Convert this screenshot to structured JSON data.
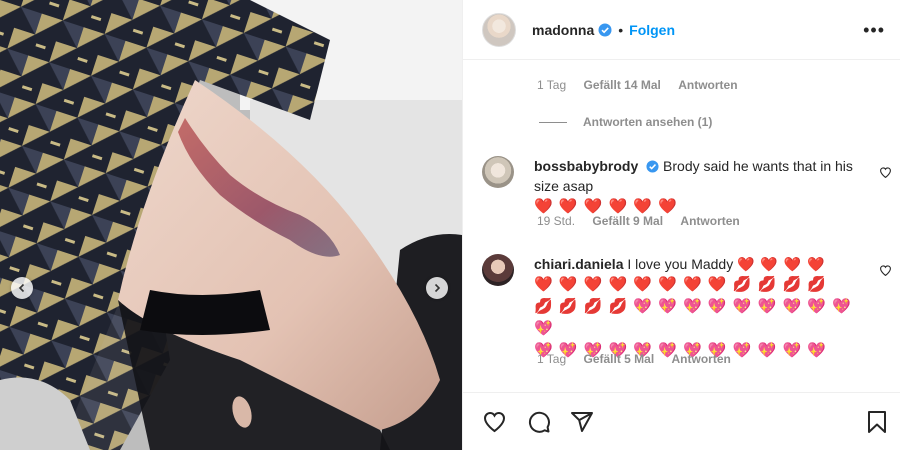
{
  "header": {
    "username": "madonna",
    "separator": "•",
    "follow_label": "Folgen",
    "more_label": "•••"
  },
  "top_reply_meta": {
    "time": "1 Tag",
    "likes": "Gefällt 14 Mal",
    "reply_label": "Antworten"
  },
  "view_replies_label": "Antworten ansehen (1)",
  "comments": [
    {
      "username": "bossbabybrody",
      "verified": true,
      "text": "Brody said he wants that in his size asap",
      "emoji_lines": [
        "❤️ ❤️ ❤️ ❤️ ❤️ ❤️"
      ],
      "time": "19 Std.",
      "likes": "Gefällt 9 Mal",
      "reply_label": "Antworten"
    },
    {
      "username": "chiari.daniela",
      "verified": false,
      "text": "I love you Maddy",
      "emoji_lines": [
        "❤️ ❤️ ❤️ ❤️",
        "❤️ ❤️ ❤️ ❤️ ❤️ ❤️ ❤️ ❤️ 💋 💋 💋 💋",
        "💋 💋 💋 💋 💖 💖 💖 💖 💖 💖 💖 💖 💖 💖",
        "💖 💖 💖 💖 💖 💖 💖 💖 💖 💖 💖 💖"
      ],
      "time": "1 Tag",
      "likes": "Gefällt 5 Mal",
      "reply_label": "Antworten"
    }
  ],
  "icons": {
    "verified_color": "#3897f0",
    "like": "heart-icon",
    "comment": "comment-icon",
    "share": "share-icon",
    "save": "bookmark-icon"
  }
}
